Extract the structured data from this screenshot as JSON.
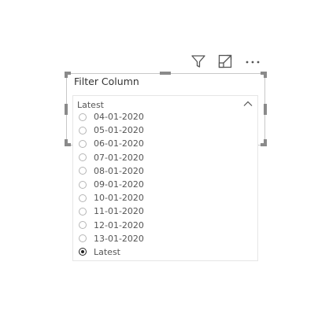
{
  "visual": {
    "title": "Filter Column",
    "toolbar": {
      "icons": [
        "filter-icon",
        "focus-mode-icon",
        "more-options-icon"
      ]
    }
  },
  "dropdown": {
    "selected_value": "Latest"
  },
  "list": {
    "items": [
      {
        "label": "04-01-2020",
        "checked": false
      },
      {
        "label": "05-01-2020",
        "checked": false
      },
      {
        "label": "06-01-2020",
        "checked": false
      },
      {
        "label": "07-01-2020",
        "checked": false
      },
      {
        "label": "08-01-2020",
        "checked": false
      },
      {
        "label": "09-01-2020",
        "checked": false
      },
      {
        "label": "10-01-2020",
        "checked": false
      },
      {
        "label": "11-01-2020",
        "checked": false
      },
      {
        "label": "12-01-2020",
        "checked": false
      },
      {
        "label": "13-01-2020",
        "checked": false
      },
      {
        "label": "Latest",
        "checked": true
      }
    ]
  }
}
